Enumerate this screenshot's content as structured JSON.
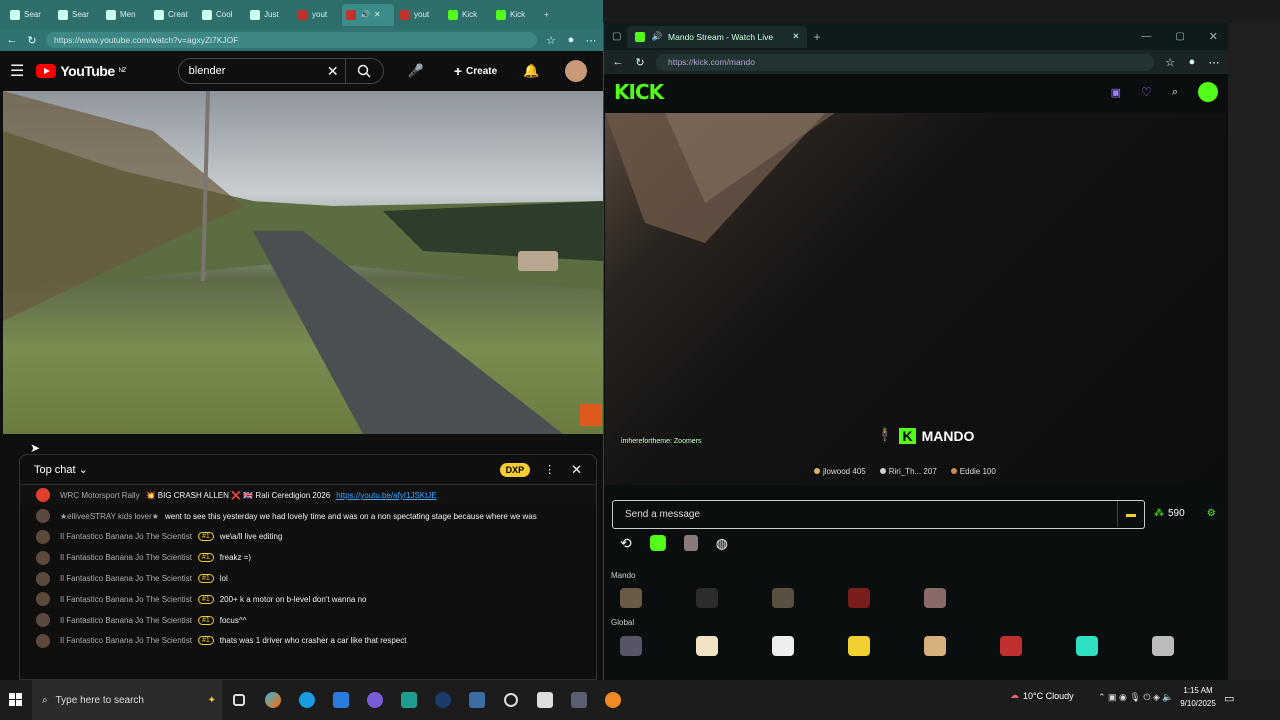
{
  "left_browser": {
    "tabs": [
      {
        "label": "Sear"
      },
      {
        "label": "Sear"
      },
      {
        "label": "Men"
      },
      {
        "label": "Creat"
      },
      {
        "label": "Cool"
      },
      {
        "label": "Just"
      },
      {
        "label": "yout"
      },
      {
        "label": ""
      },
      {
        "label": "yout"
      },
      {
        "label": "Kick"
      },
      {
        "label": "Kick"
      }
    ],
    "url": "https://www.youtube.com/watch?v=agxyZi7KJOF",
    "youtube": {
      "logo_text": "YouTube",
      "region": "NZ",
      "search_value": "blender",
      "create_label": "Create"
    },
    "chat": {
      "mode_label": "Top chat",
      "points_label": "DXP",
      "messages": [
        {
          "name": "WRC Motorsport Rally",
          "badge": "",
          "pre": "💥 BIG CRASH ALLEN ❌ 🇬🇧 Rali Ceredigion 2026",
          "link": "https://youtu.be/afyI1JSKtJE"
        },
        {
          "name": "★elliveeSTRAY kids lover★",
          "badge": "",
          "pre": "went to see this yesterday we had lovely time and was on a non spectating stage because where we was",
          "link": ""
        },
        {
          "name": "Il Fantastico Banana Jo The Scientist",
          "badge": "#1",
          "pre": "we\\a/ll live editing",
          "link": ""
        },
        {
          "name": "Il Fantastico Banana Jo The Scientist",
          "badge": "#1",
          "pre": "freakz =)",
          "link": ""
        },
        {
          "name": "Il Fantastico Banana Jo The Scientist",
          "badge": "#1",
          "pre": "lol",
          "link": ""
        },
        {
          "name": "Il Fantastico Banana Jo The Scientist",
          "badge": "#1",
          "pre": "200+ k a motor on b-level don't wanna no",
          "link": ""
        },
        {
          "name": "Il Fantastico Banana Jo The Scientist",
          "badge": "#1",
          "pre": "focus^^",
          "link": ""
        },
        {
          "name": "Il Fantastico Banana Jo The Scientist",
          "badge": "#1",
          "pre": "thats was 1 driver who crasher a car like that respect",
          "link": ""
        }
      ]
    }
  },
  "right_browser": {
    "tab_title": "Mando Stream - Watch Live",
    "url": "https://kick.com/mando",
    "kick": {
      "logo_text": "KICK",
      "overlay_message": "imherefortheme: Zoomers",
      "watermark": "MANDO",
      "leaderboard": [
        {
          "name": "jlowood",
          "value": "405"
        },
        {
          "name": "Riri_Th...",
          "value": "207"
        },
        {
          "name": "Eddie",
          "value": "100"
        }
      ],
      "input_placeholder": "Send a message",
      "points": "590",
      "section_mando": "Mando",
      "section_global": "Global"
    }
  },
  "taskbar": {
    "search_placeholder": "Type here to search",
    "weather": "10°C Cloudy",
    "time": "1:15 AM",
    "date": "9/10/2025"
  },
  "colors": {
    "youtube_red": "#ff0000",
    "kick_green": "#53fc18",
    "left_tab_bg": "#2e6f6c",
    "badge_gold": "#f6cc32"
  }
}
